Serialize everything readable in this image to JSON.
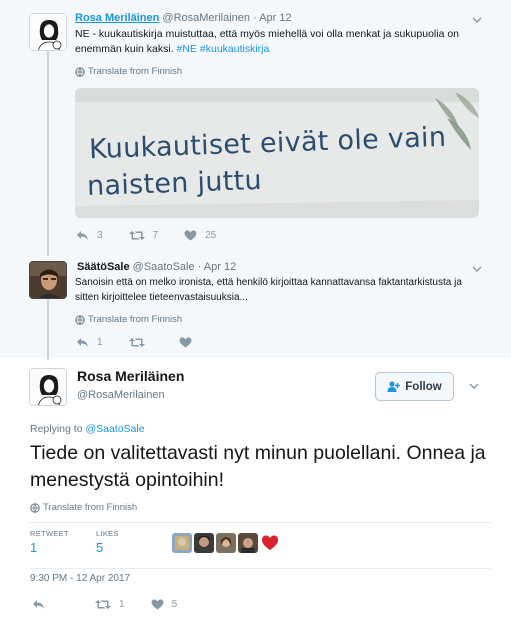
{
  "tweets": [
    {
      "name": "Rosa Meriläinen",
      "handle": "@RosaMerilainen",
      "date": "Apr 12",
      "text_a": "NE - kuukautiskirja muistuttaa, että myös miehellä voi olla menkat ja sukupuolia on enemmän kuin kaksi. ",
      "hashtag1": "#NE",
      "hashtag2": "#kuukautiskirja",
      "translate": "Translate from Finnish",
      "image_text_line1": "Kuukautiset eivät ole vain",
      "image_text_line2": "naisten juttu",
      "reply_count": "3",
      "retweet_count": "7",
      "like_count": "25"
    },
    {
      "name": "SäätöSale",
      "handle": "@SaatoSale",
      "date": "Apr 12",
      "text": "Sanoisin että on melko ironista, että henkilö kirjoittaa kannattavansa faktantarkistusta ja sitten kirjoittelee tieteenvastaisuuksia...",
      "translate": "Translate from Finnish",
      "reply_count": "1",
      "retweet_count": "",
      "like_count": ""
    }
  ],
  "main_tweet": {
    "name": "Rosa Meriläinen",
    "handle": "@RosaMerilainen",
    "follow_label": "Follow",
    "replying_prefix": "Replying to ",
    "replying_to": "@SaatoSale",
    "text": "Tiede on valitettavasti nyt minun puolellani. Onnea ja menestystä opintoihin!",
    "translate": "Translate from Finnish",
    "retweets_label": "RETWEET",
    "retweets": "1",
    "likes_label": "LIKES",
    "likes": "5",
    "timestamp": "9:30 PM - 12 Apr 2017",
    "reply_count": "",
    "retweet_count": "1",
    "like_count": "5"
  },
  "colors": {
    "accent": "#1b95e0",
    "muted": "#657786",
    "context_bg": "#f5f8fa"
  },
  "icons": [
    "reply-icon",
    "retweet-icon",
    "like-icon",
    "globe-icon",
    "chevron-down-icon",
    "follow-icon"
  ]
}
